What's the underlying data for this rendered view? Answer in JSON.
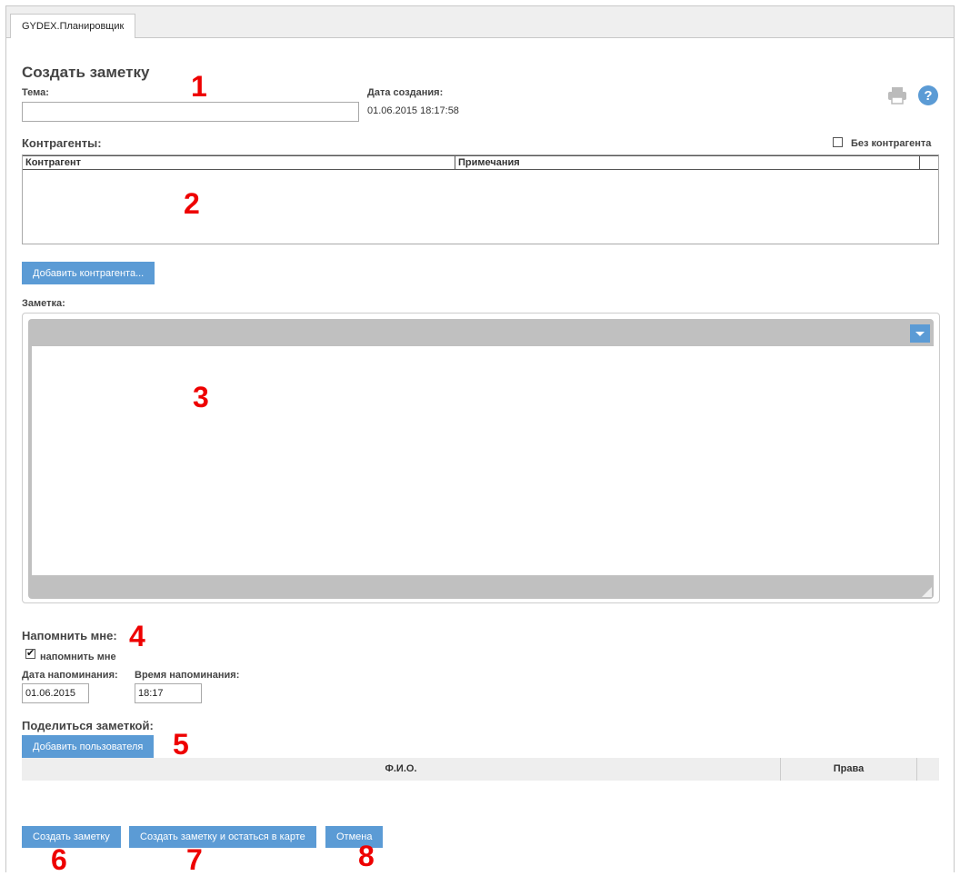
{
  "window": {
    "tab_label": "GYDEX.Планировщик"
  },
  "page_title": "Создать заметку",
  "subject": {
    "label": "Тема:",
    "value": ""
  },
  "created": {
    "label": "Дата создания:",
    "value": "01.06.2015 18:17:58"
  },
  "icons": {
    "print": "printer-icon",
    "help": "help-icon"
  },
  "contractors": {
    "label": "Контрагенты:",
    "no_contractor_label": "Без контрагента",
    "no_contractor_checked": false,
    "columns": [
      "Контрагент",
      "Примечания"
    ],
    "rows": [],
    "add_button": "Добавить контрагента..."
  },
  "note": {
    "label": "Заметка:",
    "value": ""
  },
  "reminder": {
    "label": "Напомнить мне:",
    "checkbox_label": "напомнить мне",
    "checked": true,
    "date_label": "Дата напоминания:",
    "date_value": "01.06.2015",
    "time_label": "Время напоминания:",
    "time_value": "18:17"
  },
  "share": {
    "label": "Поделиться заметкой:",
    "add_button": "Добавить пользователя",
    "columns": [
      "Ф.И.О.",
      "Права"
    ],
    "rows": []
  },
  "actions": {
    "create": "Создать заметку",
    "create_stay": "Создать заметку и остаться в карте",
    "cancel": "Отмена"
  },
  "annotations": [
    "1",
    "2",
    "3",
    "4",
    "5",
    "6",
    "7",
    "8"
  ],
  "colors": {
    "accent": "#5b9bd5",
    "annotation": "#e00000"
  }
}
